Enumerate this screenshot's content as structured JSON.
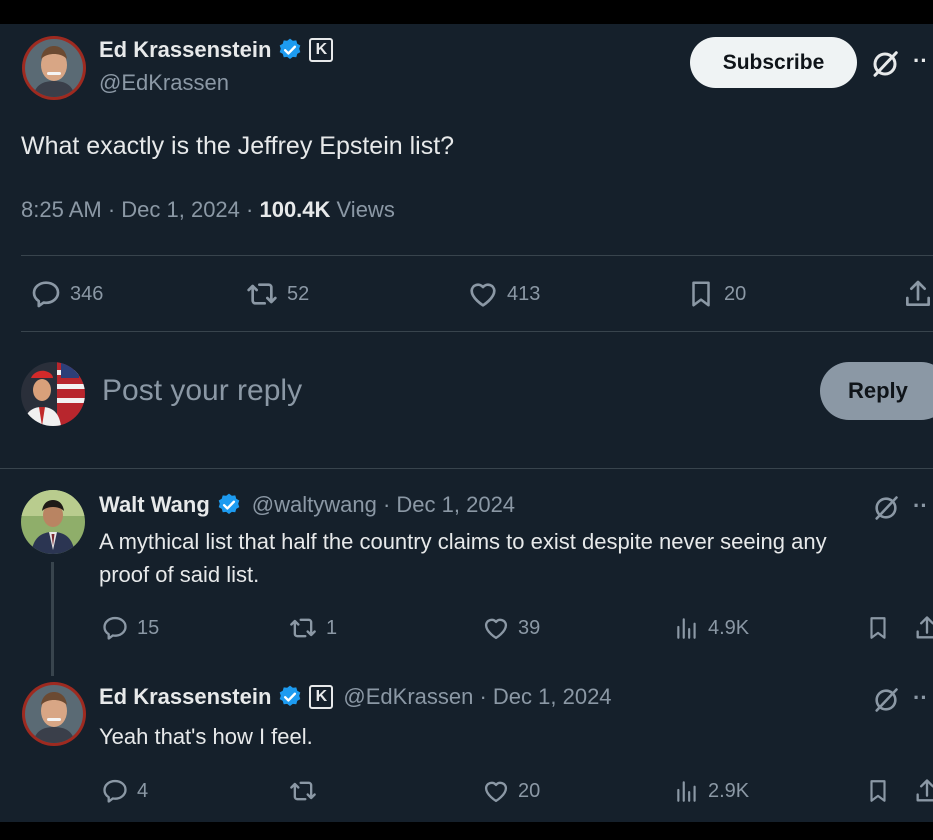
{
  "main_tweet": {
    "author_name": "Ed Krassenstein",
    "author_handle": "@EdKrassen",
    "badge_letter": "K",
    "subscribe_label": "Subscribe",
    "more_label": "··",
    "text": "What exactly is the Jeffrey Epstein list?",
    "time": "8:25 AM · Dec 1, 2024 · ",
    "views_count": "100.4K",
    "views_label": " Views",
    "replies": "346",
    "retweets": "52",
    "likes": "413",
    "bookmarks": "20"
  },
  "composer": {
    "placeholder": "Post your reply",
    "reply_label": "Reply"
  },
  "replies": [
    {
      "author_name": "Walt Wang",
      "meta": "@waltywang · Dec 1, 2024",
      "text_line1": "A mythical list that half the country claims to exist despite never seeing any",
      "text_line2": "proof of said list.",
      "replies": "15",
      "retweets": "1",
      "likes": "39",
      "views": "4.9K",
      "more_label": "··"
    },
    {
      "author_name": "Ed Krassenstein",
      "badge_letter": "K",
      "meta": "@EdKrassen · Dec 1, 2024",
      "text": "Yeah that's how I feel.",
      "replies": "4",
      "likes": "20",
      "views": "2.9K",
      "more_label": "··"
    }
  ],
  "colors": {
    "background": "#15202b",
    "text": "#e7e9ea",
    "muted": "#8b98a5",
    "verified": "#1d9bf0",
    "divider": "#38444d"
  },
  "icons": [
    "verified-badge-icon",
    "grok-slash-icon",
    "reply-icon",
    "retweet-icon",
    "like-icon",
    "bookmark-icon",
    "share-icon",
    "views-icon"
  ]
}
